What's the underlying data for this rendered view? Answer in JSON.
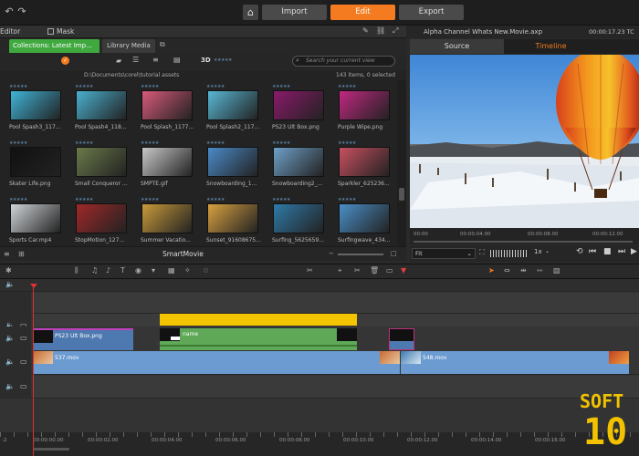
{
  "topbar": {
    "import_label": "Import",
    "edit_label": "Edit",
    "export_label": "Export"
  },
  "library": {
    "menu": {
      "editor": "Editor",
      "mask": "Mask"
    },
    "tab_collections": "Collections: Latest Imp...",
    "tab_library": "Library Media",
    "label_3d": "3D",
    "search_placeholder": "Search your current view",
    "path": "D:\\Documents\\corel\\tutorial assets",
    "count": "143 items, 0 selected",
    "items": [
      {
        "name": "Pool Spash3_117...",
        "color": "#3fb4d8"
      },
      {
        "name": "Pool Spash4_118...",
        "color": "#4ab0cf"
      },
      {
        "name": "Pool Splash_1177...",
        "color": "#d85a7a"
      },
      {
        "name": "Pool Splash2_117...",
        "color": "#58b8d5"
      },
      {
        "name": "PS23 Ult Box.png",
        "color": "#8a1a6a"
      },
      {
        "name": "Purple Wipe.png",
        "color": "#c02880"
      },
      {
        "name": "Skater Life.png",
        "color": "#111111"
      },
      {
        "name": "Small Conqueror ...",
        "color": "#6a7a4a"
      },
      {
        "name": "SMPTE.gif",
        "color": "#c8c8c8"
      },
      {
        "name": "Snowboarding_1...",
        "color": "#4a8ac8"
      },
      {
        "name": "Snowboarding2_...",
        "color": "#6fa0c8"
      },
      {
        "name": "Sparkler_625236...",
        "color": "#c85060"
      },
      {
        "name": "Sports Car.mp4",
        "color": "#cfd4d8"
      },
      {
        "name": "StopMotion_127...",
        "color": "#a02828"
      },
      {
        "name": "Summer Vacatio...",
        "color": "#c89a3a"
      },
      {
        "name": "Sunset_91608675...",
        "color": "#d8a040"
      },
      {
        "name": "Surfing_5625659...",
        "color": "#2f7aa8"
      },
      {
        "name": "Surfingwave_434...",
        "color": "#4a8fc8"
      }
    ],
    "bottom_label": "SmartMovie"
  },
  "preview": {
    "title": "Alpha Channel Whats New.Movie.axp",
    "timecode": "00:00:17.23 TC",
    "tab_source": "Source",
    "tab_timeline": "Timeline",
    "ruler_ticks": [
      "00:00",
      "00:00:04.00",
      "00:00:08.00",
      "00:00:12.00"
    ],
    "fit_label": "Fit",
    "speed_label": "1x"
  },
  "timeline": {
    "clips": {
      "overlay_name": "PS23 Ult Box.png",
      "title_name": "name",
      "video1": "537.mov",
      "video2": "548.mov"
    },
    "ruler": [
      "00:00:00.00",
      "00:00:02.00",
      "00:00:04.00",
      "00:00:06.00",
      "00:00:08.00",
      "00:00:10.00",
      "00:00:12.00",
      "00:00:14.00",
      "00:00:16.00"
    ],
    "ruler_start": "-2"
  },
  "watermark": {
    "line1": "SOFT",
    "line2": "10"
  },
  "colors": {
    "accent": "#f47b20",
    "collections_tab": "#3fa83f",
    "playhead": "#e03030",
    "title_clip": "#f5c400"
  }
}
